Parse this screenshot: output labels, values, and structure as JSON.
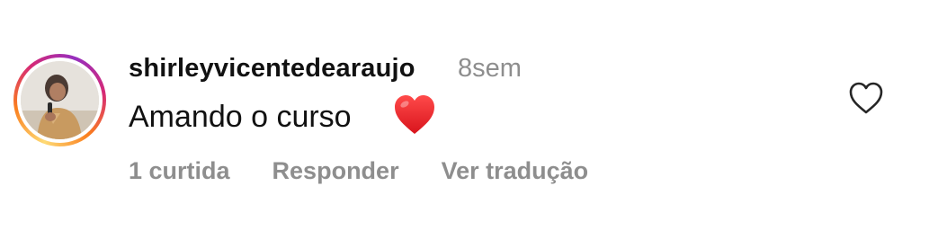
{
  "comment": {
    "username": "shirleyvicentedearaujo",
    "timestamp": "8sem",
    "text": "Amando o curso",
    "emoji": "red-heart-emoji",
    "actions": {
      "likes": "1 curtida",
      "reply": "Responder",
      "translate": "Ver tradução"
    },
    "like_icon": "heart-outline-icon",
    "colors": {
      "primary_text": "#111111",
      "secondary_text": "#8e8e8e",
      "emoji_red": "#e8232b",
      "story_ring": [
        "#feda75",
        "#fa7e1e",
        "#d62976",
        "#962fbf"
      ]
    }
  }
}
